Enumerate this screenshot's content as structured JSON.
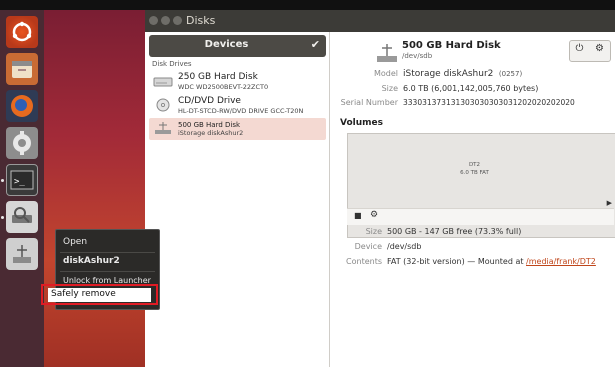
{
  "window": {
    "title": "Disks"
  },
  "devices_pane": {
    "header": "Devices",
    "section_label": "Disk Drives",
    "items": [
      {
        "name": "250 GB Hard Disk",
        "sub": "WDC WD2500BEVT-22ZCT0"
      },
      {
        "name": "CD/DVD Drive",
        "sub": "HL-DT-STCD-RW/DVD DRIVE GCC-T20N"
      },
      {
        "name": "500 GB Hard Disk",
        "sub": "iStorage diskAshur2"
      }
    ]
  },
  "detail": {
    "title": "500 GB Hard Disk",
    "device": "/dev/sdb",
    "model_label": "Model",
    "model_value": "iStorage diskAshur2",
    "model_rev": "(0257)",
    "size_label": "Size",
    "size_value": "6.0 TB (6,001,142,005,760 bytes)",
    "serial_label": "Serial Number",
    "serial_value": "333031373131303030303031202020202020",
    "volumes_title": "Volumes",
    "partition_name": "DT2",
    "partition_size": "6.0 TB FAT",
    "vol_size_label": "Size",
    "vol_size_value": "500 GB - 147 GB free (73.3% full)",
    "vol_device_label": "Device",
    "vol_device_value": "/dev/sdb",
    "contents_label": "Contents",
    "contents_value": "FAT (32-bit version) — Mounted at ",
    "mount_link": "/media/frank/DT2"
  },
  "context_menu": {
    "items": [
      "Open",
      "diskAshur2",
      "Unlock from Launcher",
      "Safely remove"
    ]
  },
  "icons": {
    "power": "⏻",
    "gear": "⚙",
    "check": "✔",
    "stop": "■",
    "settings_small": "⚙",
    "arrow": "▶"
  },
  "colors": {
    "highlight_box": "#e01b24",
    "selection": "#f4d9d2"
  }
}
